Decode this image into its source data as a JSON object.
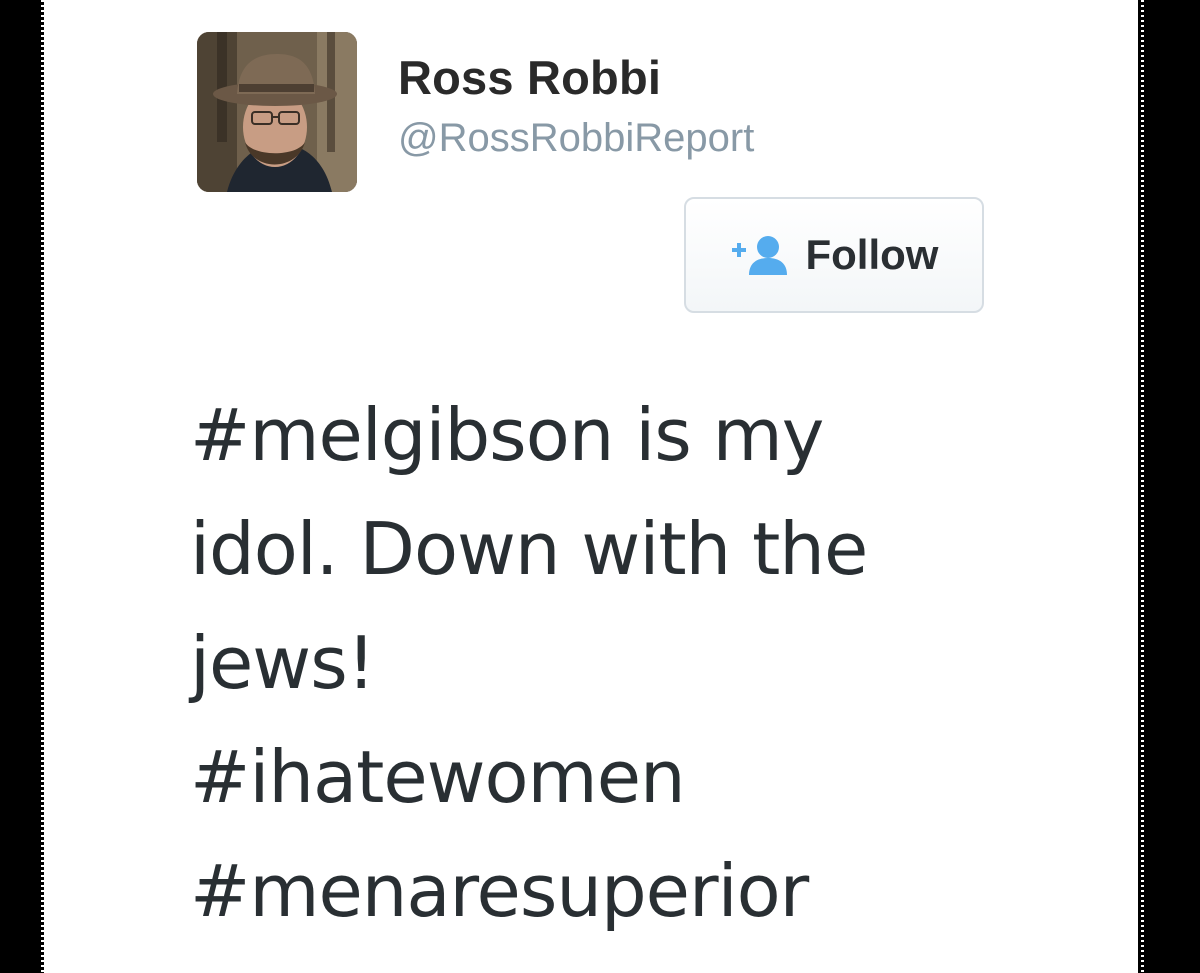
{
  "user": {
    "display_name": "Ross Robbi",
    "handle": "@RossRobbiReport"
  },
  "follow_button": {
    "label": "Follow",
    "icon": "add-user-icon"
  },
  "tweet": {
    "lines": [
      "#melgibson is my",
      "idol. Down with the",
      "jews!",
      "#ihatewomen",
      "#menaresuperior"
    ]
  },
  "colors": {
    "accent": "#55acee",
    "handle": "#8899a6",
    "text": "#292f33",
    "background": "#ffffff"
  }
}
